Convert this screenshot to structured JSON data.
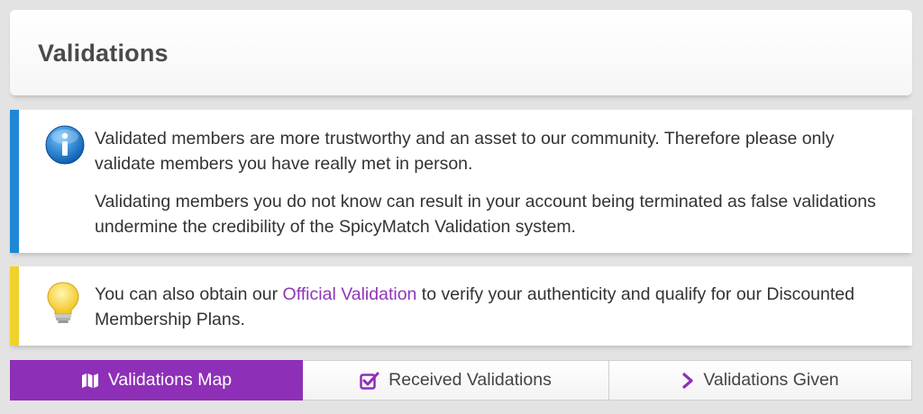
{
  "header": {
    "title": "Validations"
  },
  "info_notice": {
    "icon": "info-icon",
    "paragraph_1": "Validated members are more trustworthy and an asset to our community. Therefore please only validate members you have really met in person.",
    "paragraph_2": "Validating members you do not know can result in your account being terminated as false validations undermine the credibility of the SpicyMatch Validation system.",
    "accent_color": "#1e88d6"
  },
  "tip_notice": {
    "icon": "lightbulb-icon",
    "text_before": "You can also obtain our ",
    "link_text": "Official Validation",
    "text_after": " to verify your authenticity and qualify for our Discounted Membership Plans.",
    "accent_color": "#f0d22e",
    "link_color": "#8e37b8"
  },
  "tabs": [
    {
      "label": "Validations Map",
      "icon": "map-icon",
      "active": true
    },
    {
      "label": "Received Validations",
      "icon": "checkbox-icon",
      "active": false
    },
    {
      "label": "Validations Given",
      "icon": "chevron-right-icon",
      "active": false
    }
  ],
  "colors": {
    "active_tab": "#8e2fb8",
    "background": "#e3e3e3"
  }
}
